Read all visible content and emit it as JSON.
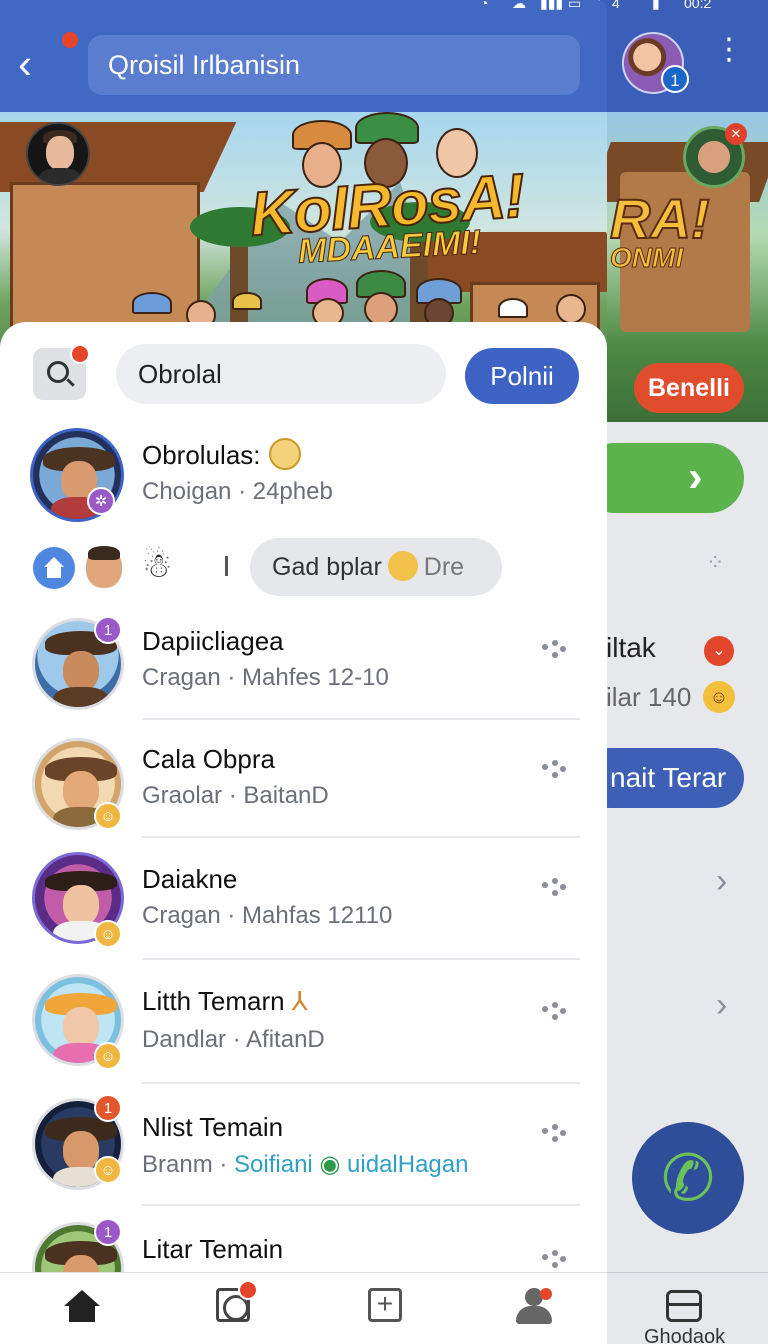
{
  "status_bar": {
    "time": "00:2",
    "battery": "4"
  },
  "header": {
    "title": "Qroisil Irlbanisin",
    "avatar_badge": "1"
  },
  "banner": {
    "title": "KoIRosA!",
    "subtitle": "MDAAEIMI!",
    "side_title": "RA!",
    "side_subtitle": "ONMI",
    "side_button": "Benelli"
  },
  "search": {
    "placeholder": "Obrolal",
    "button": "Polnii"
  },
  "pinned": {
    "name": "Obrolulas:",
    "sub": "Choigan · 24pheb"
  },
  "chip": {
    "label": "Gad bplar",
    "extra": "Dre"
  },
  "chats": [
    {
      "name": "Dapiicliagea",
      "sub": "Cragan · Mahfes 12-10",
      "badge": "1"
    },
    {
      "name": "Cala Obpra",
      "sub": "Graolar · BaitanD",
      "badge": ""
    },
    {
      "name": "Daiakne",
      "sub": "Cragan · Mahfas 12110",
      "badge": ""
    },
    {
      "name": "Litth Temarn",
      "name_mark": "⅄",
      "sub": "Dandlar · AfitanD",
      "badge": ""
    },
    {
      "name": "Nlist Temain",
      "sub_prefix": "Branm ·",
      "sub_highlight": "Soifiani",
      "sub_suffix": "uidalHagan",
      "badge": "1"
    },
    {
      "name": "Litar Temain",
      "sub": "",
      "badge": "1"
    }
  ],
  "background_panel": {
    "row_label": "iltak",
    "row_sub": "ilar 140",
    "blue_button": "nait Terar",
    "nav_label": "Ghodaok"
  },
  "colors": {
    "header_blue": "#4169c4",
    "accent_blue": "#3d63c4",
    "badge_red": "#e6452a",
    "badge_purple": "#9b59c8",
    "highlight_teal": "#2ea0c8",
    "green": "#5ab34b"
  }
}
